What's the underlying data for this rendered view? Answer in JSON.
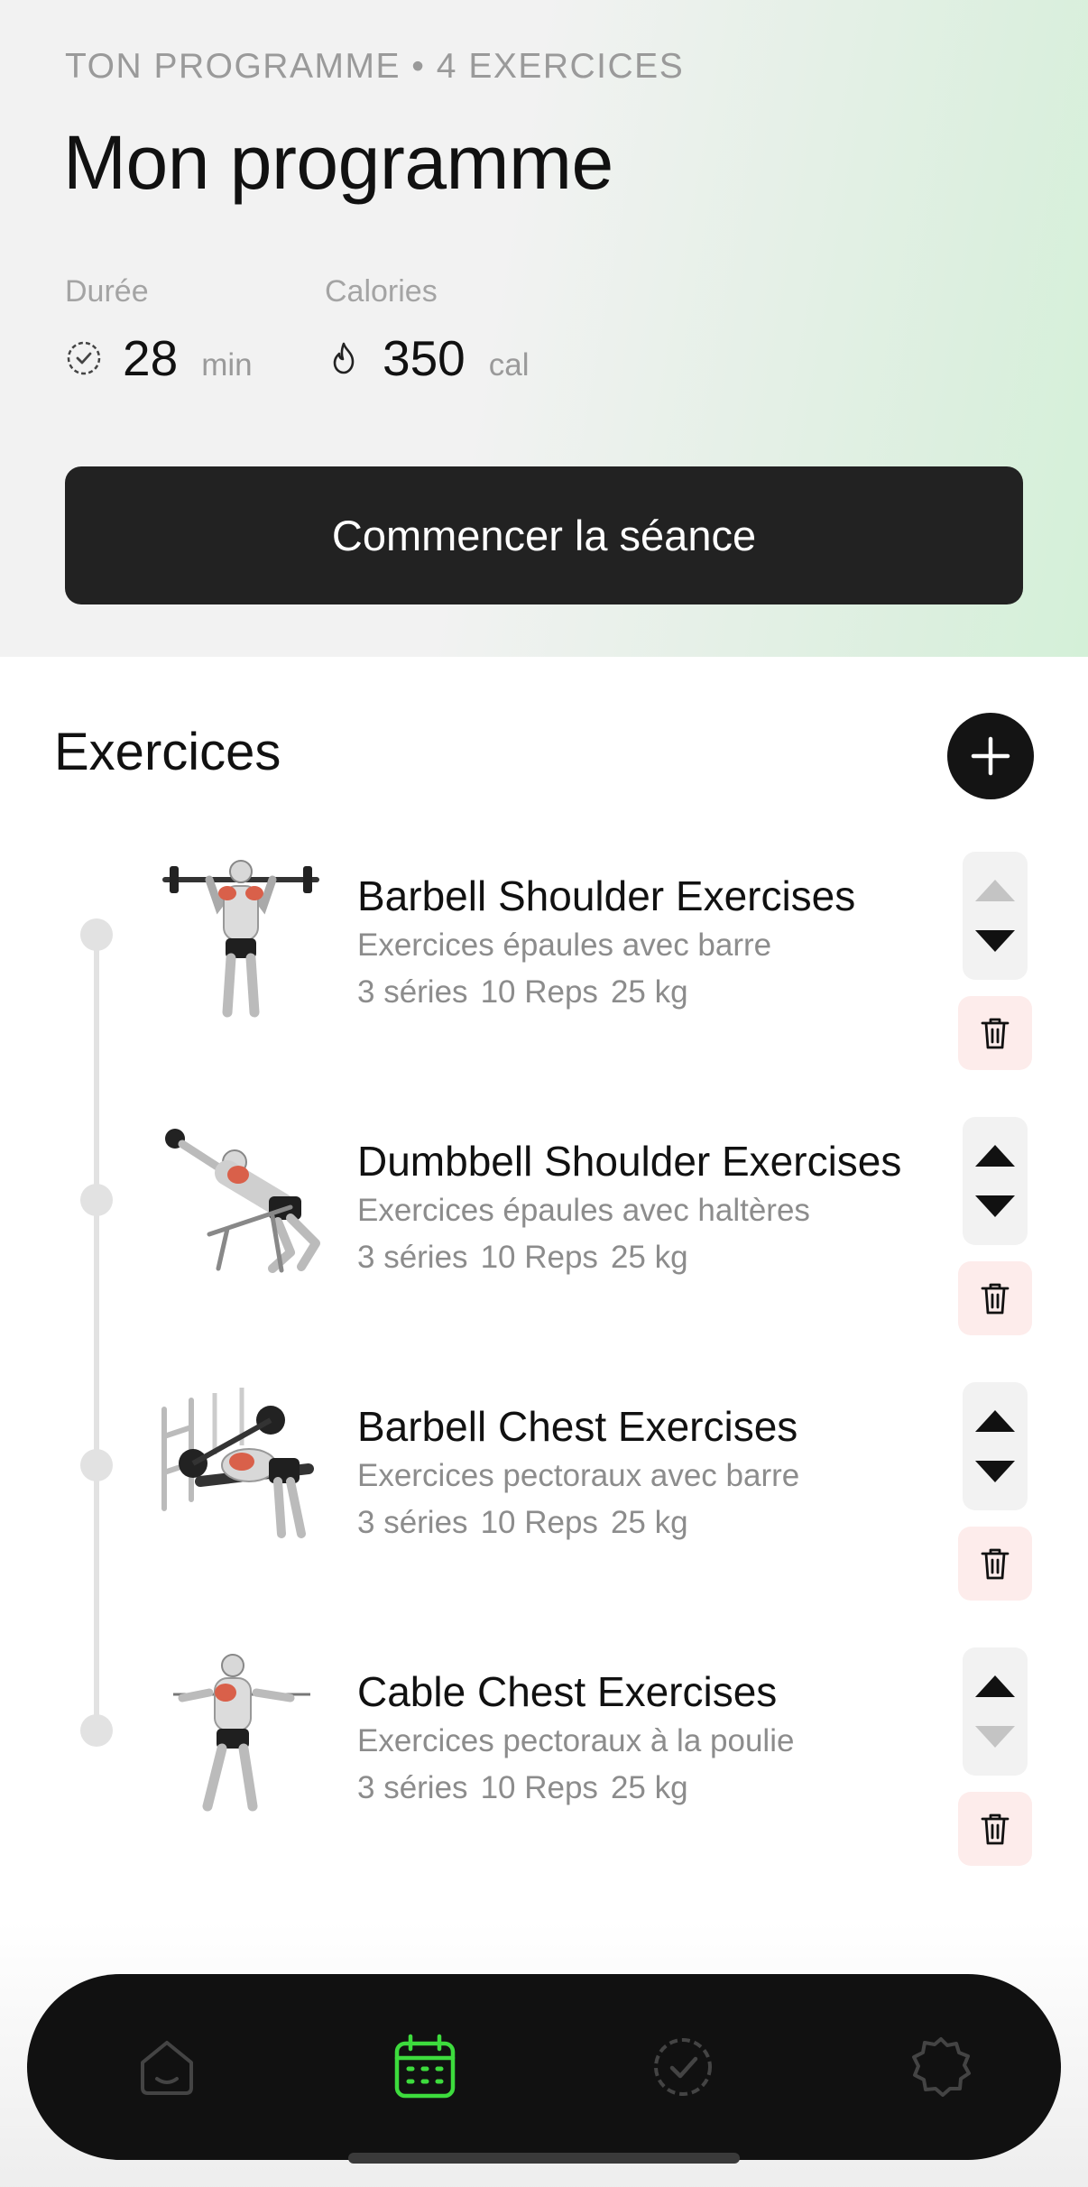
{
  "header": {
    "eyebrow": "TON PROGRAMME • 4 EXERCICES",
    "title": "Mon programme",
    "duration": {
      "label": "Durée",
      "value": "28",
      "unit": "min",
      "icon": "timer-check-icon"
    },
    "calories": {
      "label": "Calories",
      "value": "350",
      "unit": "cal",
      "icon": "flame-icon"
    },
    "cta_label": "Commencer la séance"
  },
  "section": {
    "title": "Exercices",
    "add_icon": "plus-icon"
  },
  "exercises": [
    {
      "title": "Barbell Shoulder Exercises",
      "subtitle": "Exercices épaules avec barre",
      "sets": "3 séries",
      "reps": "10 Reps",
      "weight": "25 kg",
      "can_move_up": false,
      "can_move_down": true,
      "highlight_color": "#d9604a"
    },
    {
      "title": "Dumbbell Shoulder Exercises",
      "subtitle": "Exercices épaules avec haltères",
      "sets": "3 séries",
      "reps": "10 Reps",
      "weight": "25 kg",
      "can_move_up": true,
      "can_move_down": true,
      "highlight_color": "#d9604a"
    },
    {
      "title": "Barbell Chest Exercises",
      "subtitle": "Exercices pectoraux avec barre",
      "sets": "3 séries",
      "reps": "10 Reps",
      "weight": "25 kg",
      "can_move_up": true,
      "can_move_down": true,
      "highlight_color": "#d9604a"
    },
    {
      "title": "Cable Chest Exercises",
      "subtitle": "Exercices pectoraux à la poulie",
      "sets": "3 séries",
      "reps": "10 Reps",
      "weight": "25 kg",
      "can_move_up": true,
      "can_move_down": false,
      "highlight_color": "#d9604a"
    }
  ],
  "nav": {
    "items": [
      {
        "icon": "home-icon",
        "active": false
      },
      {
        "icon": "calendar-icon",
        "active": true
      },
      {
        "icon": "check-circle-icon",
        "active": false
      },
      {
        "icon": "gear-icon",
        "active": false
      }
    ],
    "active_color": "#3ddc3d",
    "inactive_color": "#444444"
  },
  "colors": {
    "accent_dark": "#222222",
    "delete_bg": "#fdeceb",
    "arrow_disabled": "#c4c4c4"
  }
}
